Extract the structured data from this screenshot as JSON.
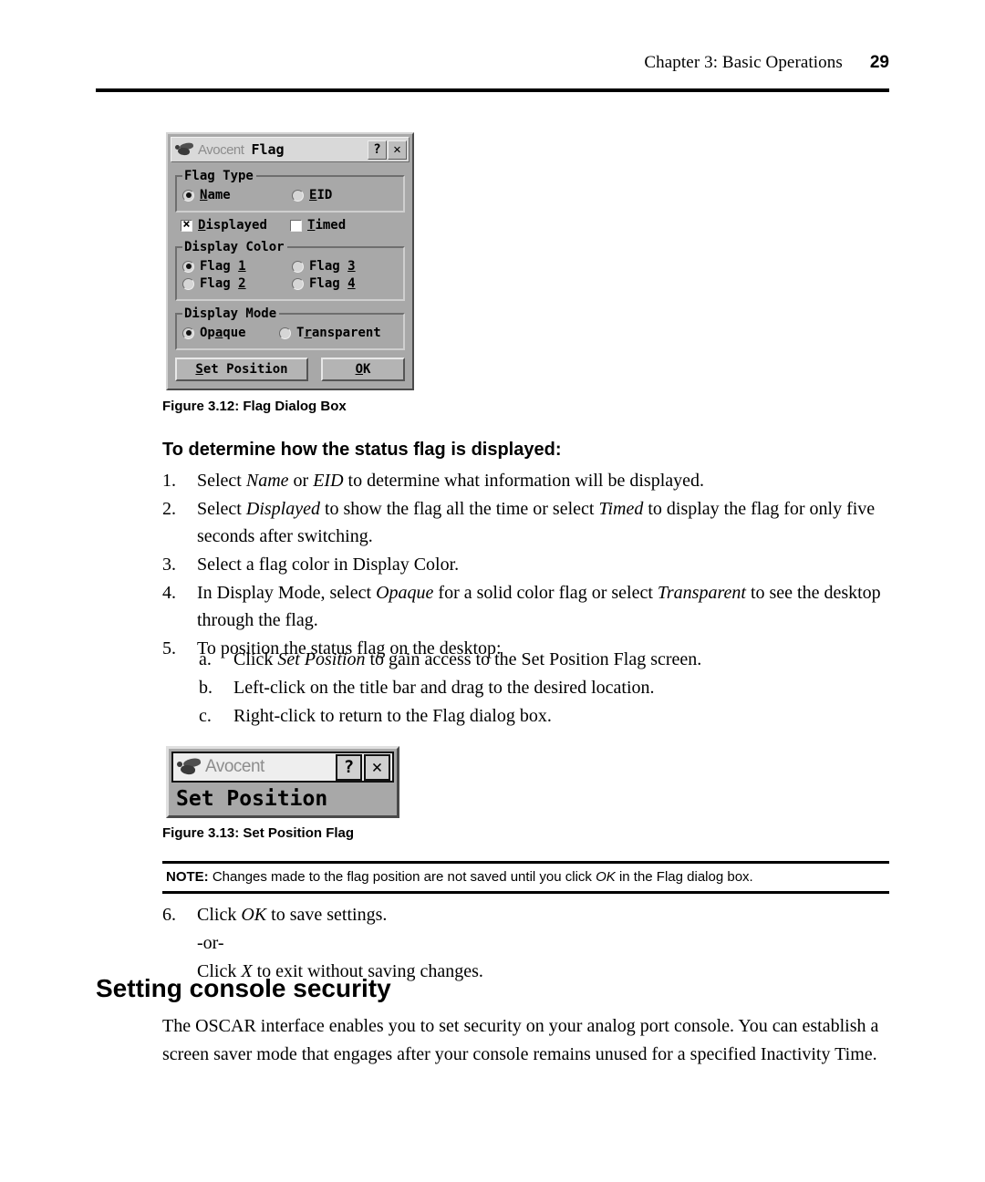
{
  "header": {
    "chapter": "Chapter 3: Basic Operations",
    "page_number": "29"
  },
  "flag_dialog": {
    "brand": "Avocent",
    "title": "Flag",
    "help_button": "?",
    "close_button": "✕",
    "flag_type": {
      "legend": "Flag Type",
      "options": [
        {
          "label": "Name",
          "mnemonic": "N",
          "selected": true
        },
        {
          "label": "EID",
          "mnemonic": "E",
          "selected": false
        }
      ]
    },
    "checkboxes": [
      {
        "label": "Displayed",
        "mnemonic": "D",
        "checked": true
      },
      {
        "label": "Timed",
        "mnemonic": "T",
        "checked": false
      }
    ],
    "display_color": {
      "legend": "Display Color",
      "options": [
        {
          "label": "Flag 1",
          "mnemonic": "1",
          "selected": true
        },
        {
          "label": "Flag 3",
          "mnemonic": "3",
          "selected": false
        },
        {
          "label": "Flag 2",
          "mnemonic": "2",
          "selected": false
        },
        {
          "label": "Flag 4",
          "mnemonic": "4",
          "selected": false
        }
      ]
    },
    "display_mode": {
      "legend": "Display Mode",
      "options": [
        {
          "label": "Opaque",
          "mnemonic": "a",
          "selected": true
        },
        {
          "label": "Transparent",
          "mnemonic": "r",
          "selected": false
        }
      ]
    },
    "buttons": {
      "set_position": "Set Position",
      "ok": "OK"
    }
  },
  "figure_312_caption": "Figure 3.12: Flag Dialog Box",
  "procedure_heading": "To determine how the status flag is displayed:",
  "steps": [
    {
      "marker": "1.",
      "parts": [
        {
          "t": "Select ",
          "i": false
        },
        {
          "t": "Name",
          "i": true
        },
        {
          "t": " or ",
          "i": false
        },
        {
          "t": "EID",
          "i": true
        },
        {
          "t": " to determine what information will be displayed.",
          "i": false
        }
      ]
    },
    {
      "marker": "2.",
      "parts": [
        {
          "t": "Select ",
          "i": false
        },
        {
          "t": "Displayed",
          "i": true
        },
        {
          "t": " to show the flag all the time or select ",
          "i": false
        },
        {
          "t": "Timed",
          "i": true
        },
        {
          "t": " to display the flag for only five seconds after switching.",
          "i": false
        }
      ]
    },
    {
      "marker": "3.",
      "parts": [
        {
          "t": "Select a flag color in Display Color.",
          "i": false
        }
      ]
    },
    {
      "marker": "4.",
      "parts": [
        {
          "t": "In Display Mode, select ",
          "i": false
        },
        {
          "t": "Opaque",
          "i": true
        },
        {
          "t": " for a solid color flag or select ",
          "i": false
        },
        {
          "t": "Transparent",
          "i": true
        },
        {
          "t": " to see the desktop through the flag.",
          "i": false
        }
      ]
    },
    {
      "marker": "5.",
      "parts": [
        {
          "t": "To position the status flag on the desktop:",
          "i": false
        }
      ]
    }
  ],
  "substeps": [
    {
      "marker": "a.",
      "parts": [
        {
          "t": "Click ",
          "i": false
        },
        {
          "t": "Set Position",
          "i": true
        },
        {
          "t": " to gain access to the Set Position Flag screen.",
          "i": false
        }
      ]
    },
    {
      "marker": "b.",
      "parts": [
        {
          "t": "Left-click on the title bar and drag to the desired location.",
          "i": false
        }
      ]
    },
    {
      "marker": "c.",
      "parts": [
        {
          "t": "Right-click to return to the Flag dialog box.",
          "i": false
        }
      ]
    }
  ],
  "set_position_window": {
    "brand": "Avocent",
    "help_button": "?",
    "close_button": "✕",
    "label": "Set Position"
  },
  "figure_313_caption": "Figure 3.13: Set Position Flag",
  "note": {
    "label": "NOTE:",
    "parts": [
      {
        "t": " Changes made to the flag position are not saved until you click ",
        "i": false
      },
      {
        "t": "OK",
        "i": true
      },
      {
        "t": " in the Flag dialog box.",
        "i": false
      }
    ]
  },
  "final_step": {
    "marker": "6.",
    "line1_parts": [
      {
        "t": "Click ",
        "i": false
      },
      {
        "t": "OK",
        "i": true
      },
      {
        "t": " to save settings.",
        "i": false
      }
    ],
    "or_text": "-or-",
    "line3_parts": [
      {
        "t": "Click ",
        "i": false
      },
      {
        "t": "X",
        "i": true
      },
      {
        "t": " to exit without saving changes.",
        "i": false
      }
    ]
  },
  "security_section": {
    "heading": "Setting console security",
    "paragraph": "The OSCAR interface enables you to set security on your analog port console. You can establish a screen saver mode that engages after your console remains unused for a specified Inactivity Time."
  }
}
